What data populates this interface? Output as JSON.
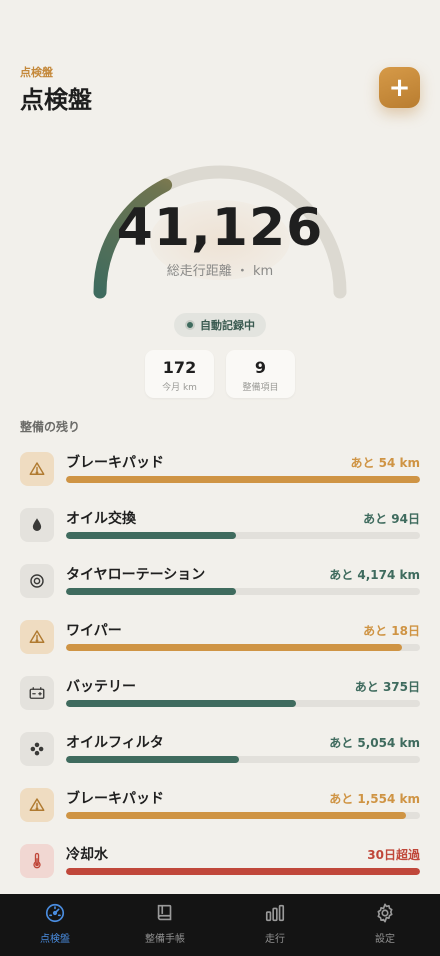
{
  "header": {
    "small_title": "点検盤",
    "title": "点検盤",
    "add_label": "+"
  },
  "odometer": {
    "value": "41,126",
    "label": "総走行距離 ・ km",
    "gauge_fill_fraction": 0.35
  },
  "auto_record": {
    "label": "自動記録中"
  },
  "stats": [
    {
      "value": "172",
      "label": "今月 km"
    },
    {
      "value": "9",
      "label": "整備項目"
    }
  ],
  "section_title": "整備の残り",
  "items": [
    {
      "name": "ブレーキパッド",
      "remaining": "あと 54 km",
      "fill": 1.0,
      "status": "warn",
      "icon": "warning-icon"
    },
    {
      "name": "オイル交換",
      "remaining": "あと 94日",
      "fill": 0.48,
      "status": "ok",
      "icon": "oil-drop-icon"
    },
    {
      "name": "タイヤローテーション",
      "remaining": "あと 4,174 km",
      "fill": 0.48,
      "status": "ok",
      "icon": "tire-icon"
    },
    {
      "name": "ワイパー",
      "remaining": "あと 18日",
      "fill": 0.95,
      "status": "warn",
      "icon": "warning-icon"
    },
    {
      "name": "バッテリー",
      "remaining": "あと 375日",
      "fill": 0.65,
      "status": "ok",
      "icon": "battery-icon"
    },
    {
      "name": "オイルフィルタ",
      "remaining": "あと 5,054 km",
      "fill": 0.49,
      "status": "ok",
      "icon": "filter-icon"
    },
    {
      "name": "ブレーキパッド",
      "remaining": "あと 1,554 km",
      "fill": 0.96,
      "status": "warn",
      "icon": "warning-icon"
    },
    {
      "name": "冷却水",
      "remaining": "30日超過",
      "fill": 1.0,
      "status": "over",
      "icon": "thermometer-icon"
    }
  ],
  "tabs": [
    {
      "label": "点検盤",
      "icon": "gauge-icon",
      "active": true
    },
    {
      "label": "整備手帳",
      "icon": "book-icon",
      "active": false
    },
    {
      "label": "走行",
      "icon": "bar-chart-icon",
      "active": false
    },
    {
      "label": "設定",
      "icon": "gear-icon",
      "active": false
    }
  ],
  "colors": {
    "accent": "#c4883a",
    "ok": "#3f6b5e",
    "warn": "#cf9444",
    "over": "#c0473a",
    "tab_active": "#4a8de0"
  }
}
